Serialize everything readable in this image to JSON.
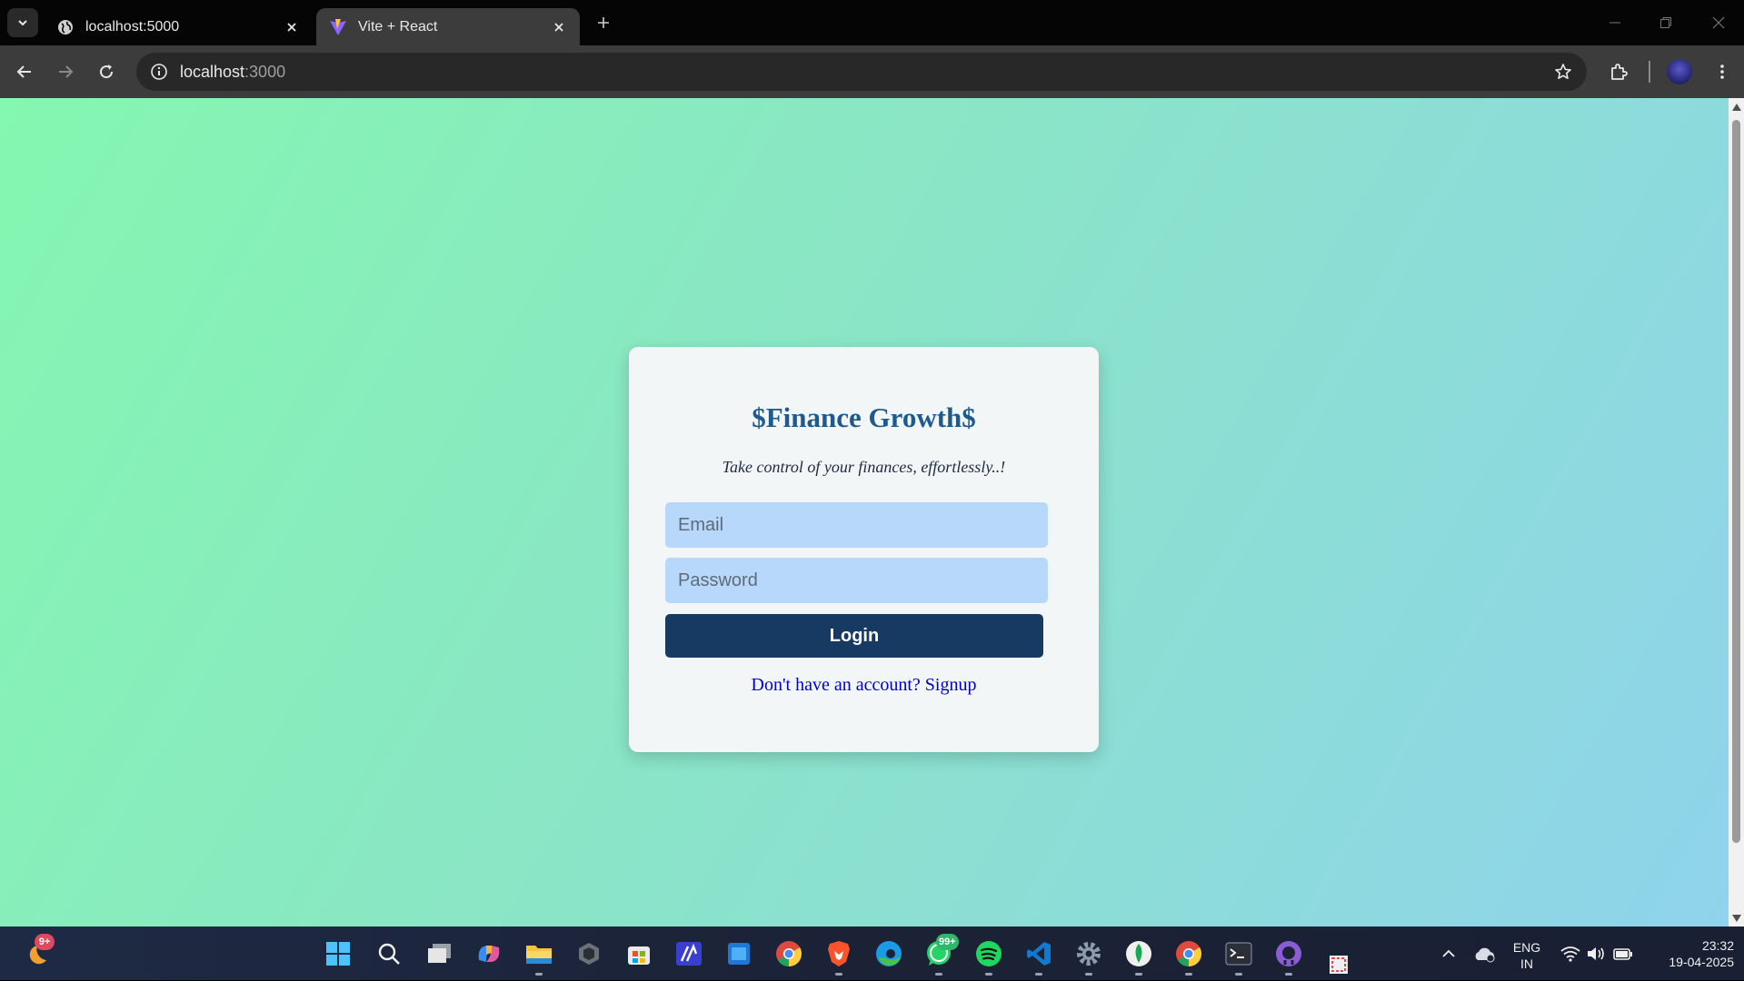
{
  "browser": {
    "tabs": [
      {
        "title": "localhost:5000",
        "favicon": "globe-icon",
        "active": false
      },
      {
        "title": "Vite + React",
        "favicon": "vite-logo-icon",
        "active": true
      }
    ],
    "address_bar": {
      "host": "localhost",
      "port": ":3000"
    }
  },
  "page": {
    "title": "$Finance Growth$",
    "tagline": "Take control of your finances, effortlessly..!",
    "email": {
      "placeholder": "Email",
      "value": ""
    },
    "password": {
      "placeholder": "Password",
      "value": ""
    },
    "login_label": "Login",
    "signup_prompt": "Don't have an account? Signup",
    "colors": {
      "title": "#1f5a8f",
      "button": "#173a63",
      "input_bg": "#b8d8fb",
      "link": "#0000cc",
      "gradient_start": "#84f7b0",
      "gradient_end": "#8fd3ec"
    }
  },
  "taskbar": {
    "pinned": [
      "start-icon",
      "search-icon",
      "task-view-icon",
      "copilot-icon",
      "file-explorer-icon",
      "app-icon",
      "microsoft-store-icon",
      "app-icon",
      "app-icon",
      "chrome-icon",
      "brave-icon",
      "edge-icon",
      "whatsapp-icon",
      "spotify-icon",
      "vscode-icon",
      "settings-icon",
      "mongodb-icon",
      "chrome-icon",
      "terminal-icon",
      "github-icon"
    ],
    "badges": {
      "widgets": "9+",
      "whatsapp": "99+"
    },
    "tray": {
      "language_line1": "ENG",
      "language_line2": "IN",
      "time": "23:32",
      "date": "19-04-2025"
    }
  }
}
